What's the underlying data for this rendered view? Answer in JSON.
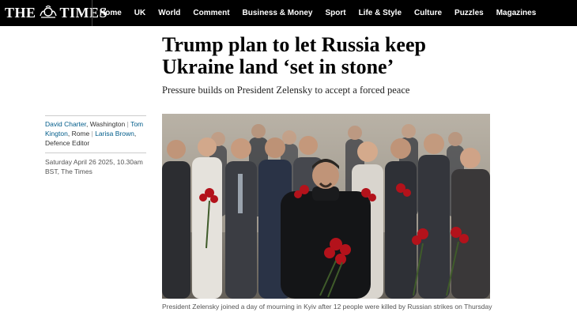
{
  "brand": {
    "logo_left": "THE",
    "logo_right": "TIMES"
  },
  "nav": {
    "items": [
      "Home",
      "UK",
      "World",
      "Comment",
      "Business & Money",
      "Sport",
      "Life & Style",
      "Culture",
      "Puzzles",
      "Magazines"
    ]
  },
  "article": {
    "headline": "Trump plan to let Russia keep Ukraine land ‘set in stone’",
    "standfirst": "Pressure builds on President Zelensky to accept a forced peace",
    "byline": {
      "author1": "David Charter",
      "loc1": ", Washington ",
      "sep1": "|",
      "author2": "Tom Kington",
      "loc2": ", Rome ",
      "sep2": "|",
      "author3": "Larisa Brown",
      "loc3": ", Defence Editor"
    },
    "dateline": "Saturday April 26 2025, 10.30am BST, The Times",
    "caption": "President Zelensky joined a day of mourning in Kyiv after 12 people were killed by Russian strikes on Thursday"
  },
  "colors": {
    "nav_bg": "#000000",
    "link_blue": "#005c8a",
    "rose_red": "#b3121b"
  }
}
